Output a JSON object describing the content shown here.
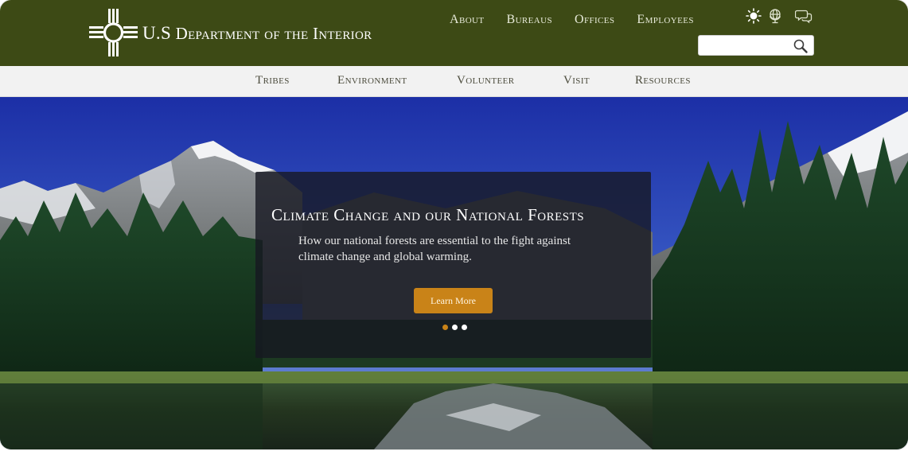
{
  "brand": {
    "name_first": "U.S",
    "name_rest": "Department of the Interior",
    "logo_icon": "zia-sun-icon"
  },
  "top_nav": [
    {
      "label": "About"
    },
    {
      "label": "Bureaus"
    },
    {
      "label": "Offices"
    },
    {
      "label": "Employees"
    }
  ],
  "utility_icons": [
    "brightness-icon",
    "globe-icon",
    "chat-icon"
  ],
  "search": {
    "placeholder": "",
    "value": "",
    "icon": "search-icon"
  },
  "sub_nav": [
    {
      "label": "Tribes"
    },
    {
      "label": "Environment"
    },
    {
      "label": "Volunteer"
    },
    {
      "label": "Visit"
    },
    {
      "label": "Resources"
    }
  ],
  "hero": {
    "title": "Climate Change and our National Forests",
    "description": "How our national forests are essential to the fight against climate change and global warming.",
    "cta_label": "Learn More",
    "slides_total": 3,
    "active_slide": 1
  },
  "colors": {
    "header_bg": "#3d4a15",
    "subnav_bg": "#f2f2f2",
    "accent": "#c98318",
    "panel_bg": "rgba(22,24,34,0.80)"
  }
}
